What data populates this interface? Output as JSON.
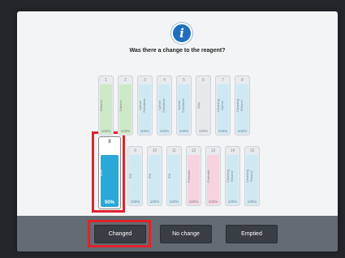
{
  "dialog": {
    "question": "Was there a change to the reagent?"
  },
  "top_row": [
    {
      "number": "1",
      "name": "Ethanol",
      "percent": "100%",
      "color": "#cde9c7"
    },
    {
      "number": "2",
      "name": "Ethanol",
      "percent": "100%",
      "color": "#cde9c7"
    },
    {
      "number": "3",
      "name": "Xylene Substitute",
      "percent": "100%",
      "color": "#cfe9f3"
    },
    {
      "number": "4",
      "name": "Xylene Substitute",
      "percent": "100%",
      "color": "#cfe9f3"
    },
    {
      "number": "5",
      "name": "Xylene Substitute",
      "percent": "100%",
      "color": "#cfe9f3"
    },
    {
      "number": "6",
      "name": "Wax",
      "percent": "100%",
      "color": "#e6e9ec"
    },
    {
      "number": "7",
      "name": "Cleaning Xylene",
      "percent": "100%",
      "color": "#cfe9f3"
    },
    {
      "number": "8",
      "name": "Cleaning Ethanol",
      "percent": "100%",
      "color": "#cfe9f3"
    }
  ],
  "bottom_row": [
    {
      "number": "9",
      "name": "IPA",
      "percent": "100%",
      "color": "#cfe9f3"
    },
    {
      "number": "10",
      "name": "IPA",
      "percent": "100%",
      "color": "#cfe9f3"
    },
    {
      "number": "11",
      "name": "IPA",
      "percent": "100%",
      "color": "#cfe9f3"
    },
    {
      "number": "12",
      "name": "Formalin",
      "percent": "100%",
      "color": "#f6d3de"
    },
    {
      "number": "13",
      "name": "Formalin",
      "percent": "100%",
      "color": "#f6d3de"
    },
    {
      "number": "14",
      "name": "Cleaning Ethanol",
      "percent": "100%",
      "color": "#cfe9f3"
    },
    {
      "number": "15",
      "name": "Cleaning Ethanol",
      "percent": "100%",
      "color": "#cfe9f3"
    }
  ],
  "selected_bottle": {
    "number": "8",
    "name": "IPA",
    "percent": "90%",
    "color": "#2aa8d8"
  },
  "buttons": {
    "changed": "Changed",
    "no_change": "No change",
    "emptied": "Emptied"
  },
  "colors": {
    "highlight": "#e0232e",
    "info_icon": "#1f6fc0"
  }
}
